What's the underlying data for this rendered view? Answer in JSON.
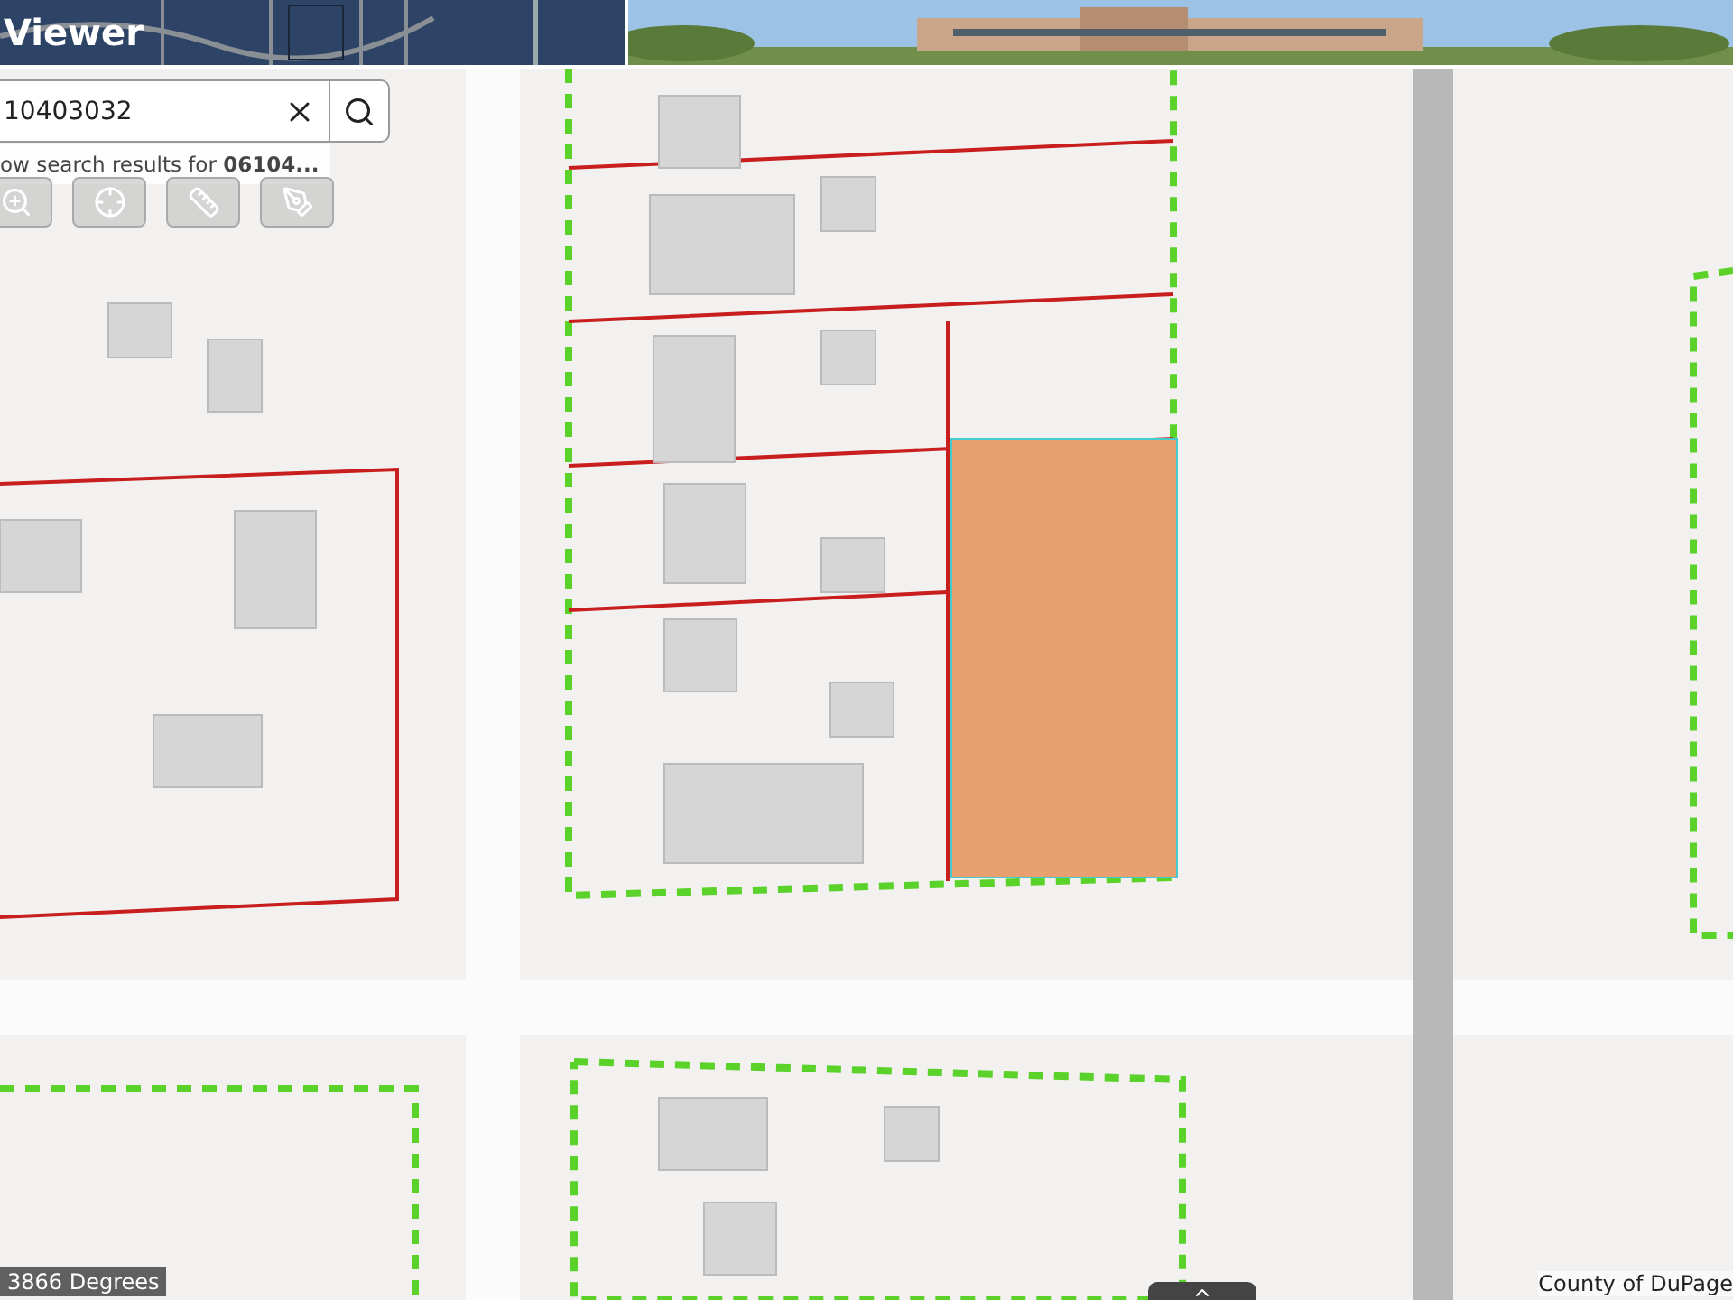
{
  "header": {
    "title": "Viewer"
  },
  "search": {
    "value": "10403032",
    "hint": "ow search results for **06104...**"
  },
  "tools": [
    {
      "kind": "zoom"
    },
    {
      "kind": "locate"
    },
    {
      "kind": "measure"
    },
    {
      "kind": "draw"
    }
  ],
  "status": {
    "coordinates": "3866 Degrees",
    "attribution": "County of DuPage"
  }
}
